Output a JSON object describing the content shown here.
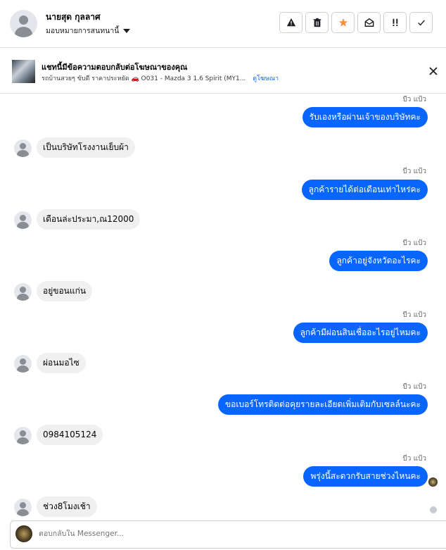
{
  "header": {
    "contact_name": "นายสุด กุลลาศ",
    "assign_label": "มอบหมายการสนทนานี้",
    "actions": [
      {
        "name": "warning",
        "glyph": "⚠"
      },
      {
        "name": "trash",
        "glyph": "🗑"
      },
      {
        "name": "star",
        "glyph": "★",
        "color": "#f7923b"
      },
      {
        "name": "mark-unread",
        "glyph": "✉"
      },
      {
        "name": "follow-up",
        "glyph": "!!"
      },
      {
        "name": "done",
        "glyph": "✓"
      }
    ]
  },
  "ad_banner": {
    "title": "แชทนี้มีข้อความตอบกลับต่อโฆษณาของคุณ",
    "subtitle": "รถบ้านสวยๆ ขับดี ราคาประหยัด 🚗 O031 - Mazda 3 1.6 Spirit (MY1...",
    "link": "ดูโฆษณา"
  },
  "messages": [
    {
      "dir": "out",
      "time": "บีว แป้ว",
      "text": "รับเองหรือผ่านเจ้าของบริษัทคะ"
    },
    {
      "dir": "in",
      "text": "เป็นบริษัทโรงงานเย็บผ้า"
    },
    {
      "dir": "out",
      "time": "บีว แป้ว",
      "text": "ลูกค้ารายได้ต่อเดือนเท่าไหร่คะ"
    },
    {
      "dir": "in",
      "text": "เดือนล่ะประมา,ณ12000"
    },
    {
      "dir": "out",
      "time": "บีว แป้ว",
      "text": "ลูกค้าอยู่จังหวัดอะไรคะ"
    },
    {
      "dir": "in",
      "text": "อยู่ขอนแก่น"
    },
    {
      "dir": "out",
      "time": "บีว แป้ว",
      "text": "ลูกค้ามีผ่อนสินเชื่ออะไรอยู่ไหมคะ"
    },
    {
      "dir": "in",
      "text": "ผ่อนมอไซ"
    },
    {
      "dir": "out",
      "time": "บีว แป้ว",
      "text": "ขอเบอร์โทรติดต่อคุยรายละเอียดเพิ่มเติมกับเซลล์นะคะ"
    },
    {
      "dir": "in",
      "text": "0984105124"
    },
    {
      "dir": "out",
      "time": "บีว แป้ว",
      "text": "พรุ่งนี้สะดวกรับสายช่วงไหนคะ"
    },
    {
      "dir": "in",
      "text": "ช่วง8โมงเช้า"
    }
  ],
  "composer": {
    "placeholder": "ตอบกลับใน Messenger..."
  },
  "colors": {
    "accent": "#0866ff",
    "incoming_bubble": "#f0f0f0",
    "star": "#f7923b"
  }
}
